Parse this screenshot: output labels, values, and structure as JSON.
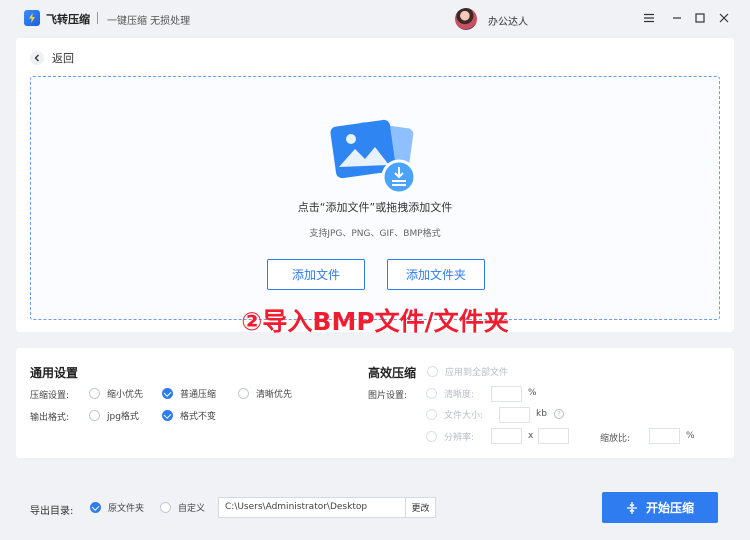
{
  "titlebar": {
    "app_name": "飞转压缩",
    "slogan": "一键压缩 无损处理",
    "user_name": "办公达人"
  },
  "main": {
    "back_label": "返回",
    "drop_hint": "点击“添加文件”或拖拽添加文件",
    "drop_sub": "支持JPG、PNG、GIF、BMP格式",
    "add_file_label": "添加文件",
    "add_folder_label": "添加文件夹"
  },
  "overlay_caption": "②导入BMP文件/文件夹",
  "general_settings": {
    "title": "通用设置",
    "compress_label": "压缩设置:",
    "compress_options": [
      "缩小优先",
      "普通压缩",
      "清晰优先"
    ],
    "compress_selected": "普通压缩",
    "format_label": "输出格式:",
    "format_options": [
      "jpg格式",
      "格式不变"
    ],
    "format_selected": "格式不变"
  },
  "advanced": {
    "title": "高效压缩",
    "apply_all": "应用到全部文件",
    "image_label": "图片设置:",
    "clarity_label": "清晰度:",
    "clarity_unit": "%",
    "size_label": "文件大小:",
    "size_unit": "kb",
    "resolution_label": "分辨率:",
    "resolution_x": "x",
    "scale_label": "缩放比:",
    "scale_unit": "%"
  },
  "bottom": {
    "output_label": "导出目录:",
    "opt_original": "原文件夹",
    "opt_custom": "自定义",
    "path_value": "C:\\Users\\Administrator\\Desktop",
    "change_label": "更改",
    "start_label": "开始压缩"
  },
  "colors": {
    "accent": "#2f7bf0",
    "caption": "#f01d2e"
  }
}
